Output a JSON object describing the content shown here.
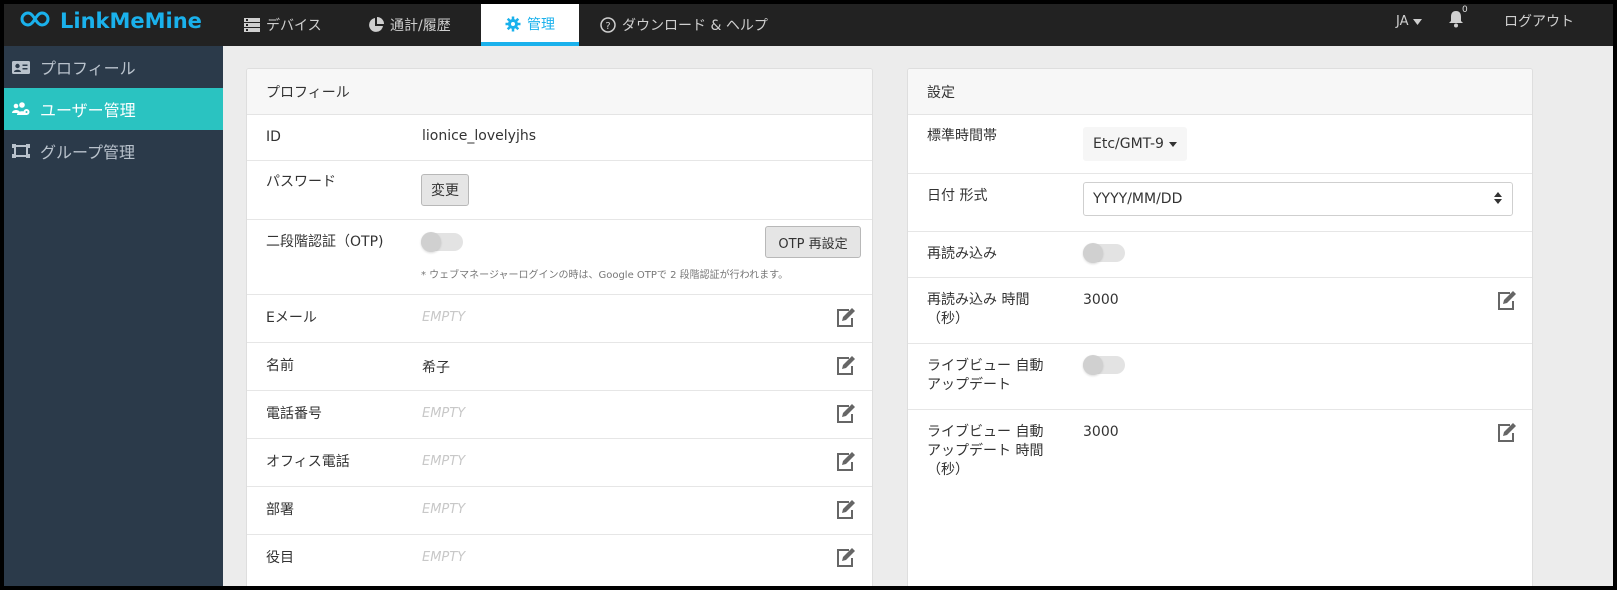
{
  "app": {
    "logo_text": "LinkMeMine",
    "brand_color": "#1ab1ec",
    "accent_color": "#2ac3c1"
  },
  "header": {
    "tabs": [
      {
        "label": "デバイス",
        "icon": "server-icon"
      },
      {
        "label": "通計/履歴",
        "icon": "pie-chart-icon"
      },
      {
        "label": "管理",
        "icon": "gear-icon",
        "active": true
      },
      {
        "label": "ダウンロード & ヘルプ",
        "icon": "question-circle-icon"
      }
    ],
    "language": "JA",
    "notification_count": "0",
    "logout_label": "ログアウト"
  },
  "sidebar": {
    "items": [
      {
        "label": "プロフィール",
        "icon": "id-card-icon"
      },
      {
        "label": "ユーザー管理",
        "icon": "users-icon",
        "active": true
      },
      {
        "label": "グループ管理",
        "icon": "group-frame-icon"
      }
    ]
  },
  "profile": {
    "title": "プロフィール",
    "id_label": "ID",
    "id_value": "lionice_lovelyjhs",
    "password_label": "パスワード",
    "password_button": "変更",
    "otp_label": "二段階認証（OTP)",
    "otp_enabled": false,
    "otp_button": "OTP 再設定",
    "otp_note": "* ウェブマネージャーログインの時は、Google OTPで 2 段階認証が行われます。",
    "fields": [
      {
        "label": "Eメール",
        "value": "EMPTY",
        "empty": true
      },
      {
        "label": "名前",
        "value": "希子",
        "empty": false
      },
      {
        "label": "電話番号",
        "value": "EMPTY",
        "empty": true
      },
      {
        "label": "オフィス電話",
        "value": "EMPTY",
        "empty": true
      },
      {
        "label": "部署",
        "value": "EMPTY",
        "empty": true
      },
      {
        "label": "役目",
        "value": "EMPTY",
        "empty": true
      }
    ]
  },
  "settings": {
    "title": "設定",
    "timezone_label": "標準時間帯",
    "timezone_value": "Etc/GMT-9",
    "date_format_label": "日付 形式",
    "date_format_value": "YYYY/MM/DD",
    "reload_label": "再読み込み",
    "reload_enabled": false,
    "reload_time_label_1": "再読み込み 時間",
    "reload_time_label_2": "（秒）",
    "reload_time_value": "3000",
    "liveview_label_1": "ライブビュー 自動",
    "liveview_label_2": "アップデート",
    "liveview_enabled": false,
    "liveview_time_label_1": "ライブビュー 自動",
    "liveview_time_label_2": "アップデート 時間",
    "liveview_time_label_3": "（秒）",
    "liveview_time_value": "3000"
  }
}
